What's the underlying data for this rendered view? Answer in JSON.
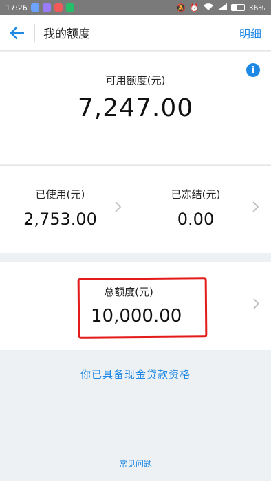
{
  "statusbar": {
    "time": "17:26",
    "battery": "36%",
    "battery_level": 0.36,
    "app_icons": [
      {
        "name": "app-icon-1",
        "color": "#6ea2ff"
      },
      {
        "name": "app-icon-2",
        "color": "#9b7cff"
      },
      {
        "name": "weibo-icon",
        "color": "#f05a5a"
      },
      {
        "name": "app-icon-4",
        "color": "#27c06a"
      }
    ]
  },
  "navbar": {
    "title": "我的额度",
    "action": "明细"
  },
  "available": {
    "label": "可用额度(元)",
    "value": "7,247.00"
  },
  "used": {
    "label": "已使用(元)",
    "value": "2,753.00"
  },
  "frozen": {
    "label": "已冻结(元)",
    "value": "0.00"
  },
  "total": {
    "label": "总额度(元)",
    "value": "10,000.00"
  },
  "links": {
    "cash_loan": "你已具备现金贷款资格",
    "faq": "常见问题"
  },
  "colors": {
    "accent": "#1e88e5",
    "highlight": "#e31b1b"
  }
}
